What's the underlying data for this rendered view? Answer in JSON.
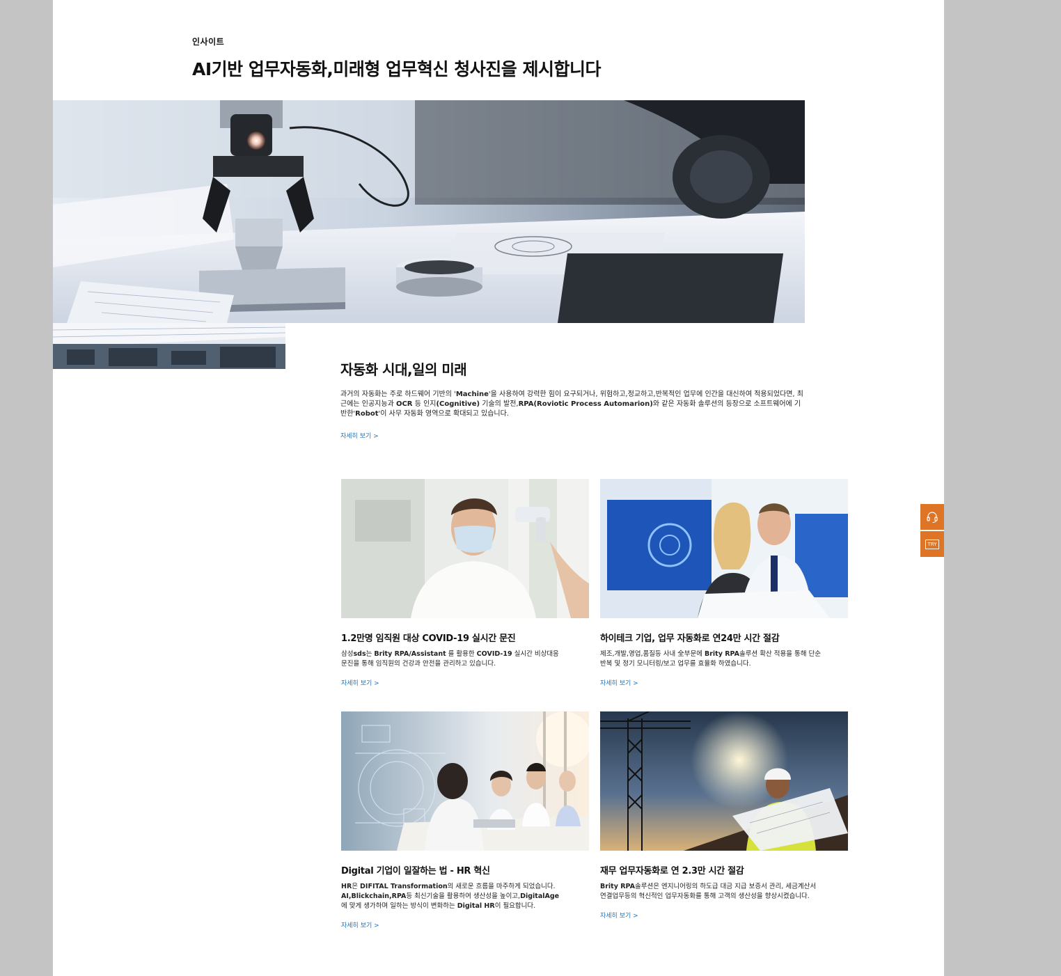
{
  "header": {
    "eyebrow": "인사이트",
    "headline": "AI기반 업무자동화,미래형 업무혁신 청사진을 제시합니다"
  },
  "feature": {
    "title": "자동화 시대,일의 미래",
    "p1": "과거의 자동화는 주로 하드웨어 기반의 '",
    "p1_b1": "Machine",
    "p2": "'을 사용하여 강력한 힘이 요구되거나, 위험하고,정교하고,반복적인 업무에 인간을 대신하여 적용되었다면, 최근에는 인공지능과 ",
    "p2_b2": "OCR",
    "p3": " 등 인지",
    "p3_b3": "(Cognitive)",
    "p4": " 기술의 발전,",
    "p4_b4": "RPA(Roviotic Process Automarion)",
    "p5": "와 같은 자동화 솔루션의 등장으로 소프트웨어에 기반한'",
    "p5_b5": "Robot",
    "p6": "'이 사무 자동화 영역으로 확대되고 있습니다.",
    "more": "자세히 보기 >"
  },
  "cards": [
    {
      "title": "1.2만명 임직원 대상 COVID-19 실시간 문진",
      "a1": "삼성",
      "a1b": "sds",
      "a2": "는 ",
      "a2b": "Brity RPA/Assistant",
      "a3": " 를 활용한 ",
      "a3b": "COVID-19",
      "a4": " 실시간 비상대응 문진을 통해 임직원의 건강과 안전을 관리하고 있습니다.",
      "more": "자세히 보기 >"
    },
    {
      "title": "하이테크 기업, 업무 자동화로 연24만 시간 절감",
      "a1": "제조,개발,영업,품질등 사내 全부문에 ",
      "a1b": "Brity RPA",
      "a2": "솔루션 확산 적용을 통해 단순 반복 및 정기 모니터링/보고 업무를 효율화 하였습니다.",
      "more": "자세히 보기 >"
    },
    {
      "title": "Digital 기업이 일잘하는 법 - HR 혁신",
      "a1b": "HR",
      "a2": "은 ",
      "a2b": "DIFITAL Transformation",
      "a3": "의 새로운 흐름을 마주하게 되었습니다. ",
      "a3b": "AI,Blickchain,RPA",
      "a4": "등 최신기술을 활용하여 생산성을 높이고,",
      "a4b": "DigitalAge",
      "a5": "에 맞게 생가하며 일하는 방식이 변화하는 ",
      "a5b": "Digital HR",
      "a6": "이 필요합니다.",
      "more": "자세히 보기 >"
    },
    {
      "title": "재무 업무자동화로 연 2.3만 시간 절감",
      "a1b": "Brity RPA",
      "a2": "솔루션은 엔지니어링의 하도급 대금 지급 보증서 관리, 세금계산서 연결업무등의 혁신적인 업무자동화를 통해 고객의 생산성을 향상시켰습니다.",
      "more": "자세히 보기 >"
    }
  ],
  "side": {
    "try_label": "TRY",
    "support_icon": "headset-icon"
  },
  "colors": {
    "accent": "#de7426",
    "link": "#1f6fb5",
    "frame": "#c4c4c4"
  }
}
